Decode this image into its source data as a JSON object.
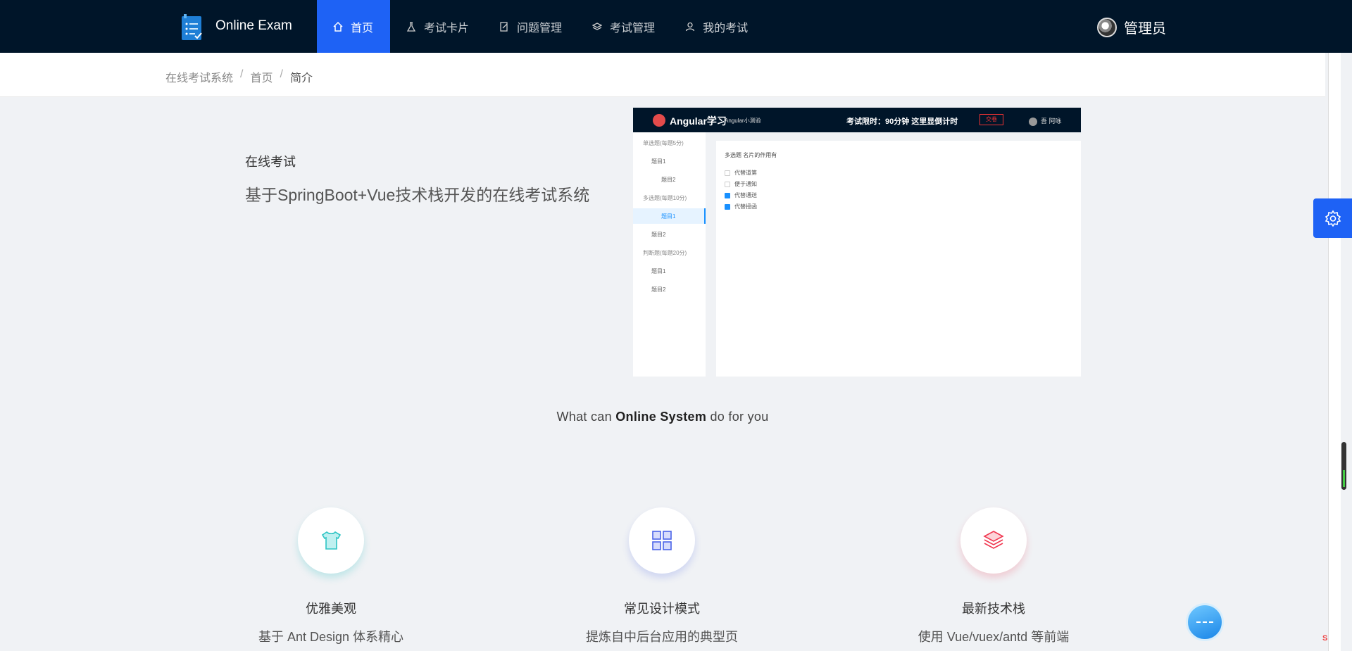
{
  "header": {
    "app_title": "Online Exam",
    "nav": [
      {
        "label": "首页",
        "icon": "home-icon",
        "active": true
      },
      {
        "label": "考试卡片",
        "icon": "experiment-icon",
        "active": false
      },
      {
        "label": "问题管理",
        "icon": "edit-document-icon",
        "active": false
      },
      {
        "label": "考试管理",
        "icon": "layers-icon",
        "active": false
      },
      {
        "label": "我的考试",
        "icon": "user-icon",
        "active": false
      }
    ],
    "user_name": "管理员",
    "active_color": "#1e62f5",
    "bg_color": "#001529"
  },
  "breadcrumb": [
    "在线考试系统",
    "首页",
    "简介"
  ],
  "intro": {
    "title": "在线考试",
    "description": "基于SpringBoot+Vue技术栈开发的在线考试系统"
  },
  "preview": {
    "title": "Angular学习",
    "subtitle": "Angular小测验",
    "timer": "考试限时：90分钟 这里显倒计时",
    "submit": "交卷",
    "user": "吾 阿咏",
    "sidebar": [
      {
        "label": "单选题(每题5分)",
        "group": true
      },
      {
        "label": "题目1",
        "group": false
      },
      {
        "label": "题目2",
        "group": false
      },
      {
        "label": "多选题(每题10分)",
        "group": true
      },
      {
        "label": "题目1",
        "group": false,
        "selected": true
      },
      {
        "label": "题目2",
        "group": false
      },
      {
        "label": "判断题(每题20分)",
        "group": true
      },
      {
        "label": "题目1",
        "group": false
      },
      {
        "label": "题目2",
        "group": false
      }
    ],
    "question": "多选题 名片的作用有",
    "options": [
      {
        "label": "代替道第",
        "checked": false
      },
      {
        "label": "便于通知",
        "checked": false
      },
      {
        "label": "代替通送",
        "checked": true
      },
      {
        "label": "代替授函",
        "checked": true
      }
    ]
  },
  "what_can": {
    "prefix": "What can ",
    "emphasis": "Online System",
    "suffix": " do for you"
  },
  "features": [
    {
      "title": "优雅美观",
      "desc": "基于 Ant Design 体系精心",
      "icon": "shirt-icon",
      "color": "#2ec4c4"
    },
    {
      "title": "常见设计模式",
      "desc": "提炼自中后台应用的典型页",
      "icon": "appstore-icon",
      "color": "#4a63e8"
    },
    {
      "title": "最新技术栈",
      "desc": "使用 Vue/vuex/antd 等前端",
      "icon": "stack-icon",
      "color": "#f0364f"
    }
  ]
}
